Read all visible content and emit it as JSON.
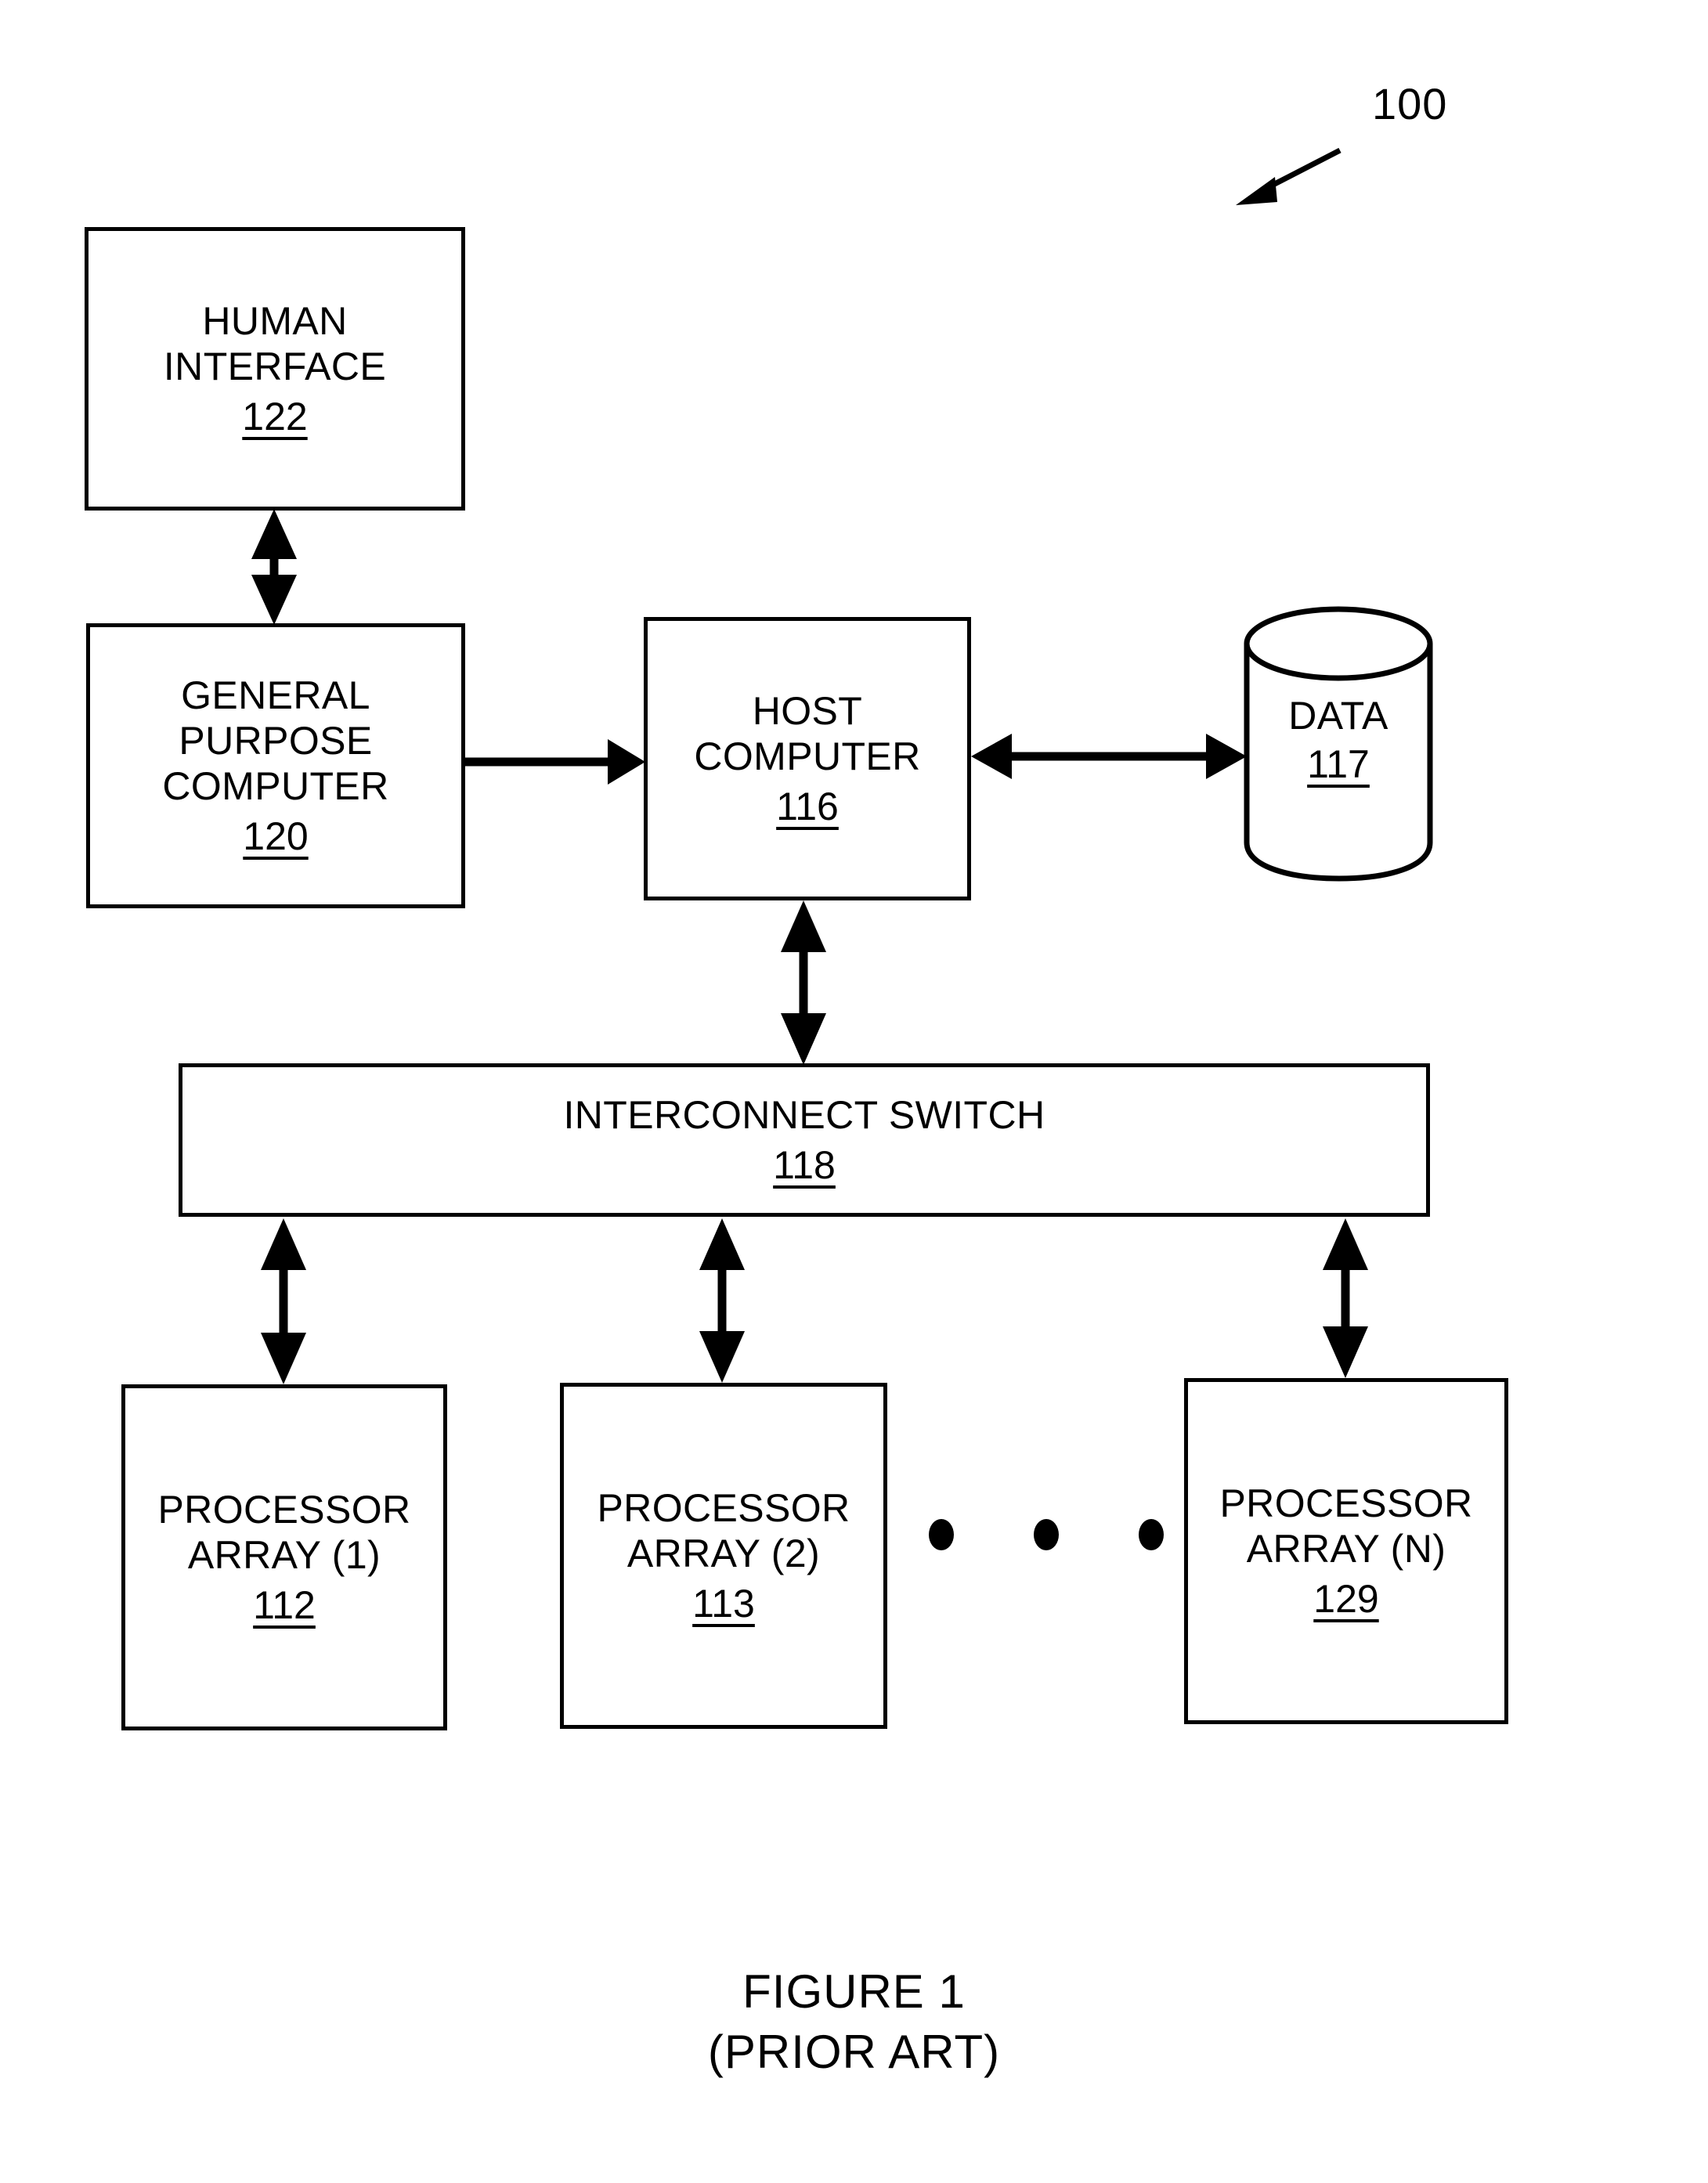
{
  "figure": {
    "system_reference": "100",
    "caption_line_1": "FIGURE 1",
    "caption_line_2": "(PRIOR ART)"
  },
  "nodes": {
    "human_interface": {
      "line_1": "HUMAN",
      "line_2": "INTERFACE",
      "ref": "122"
    },
    "general_purpose_computer": {
      "line_1": "GENERAL",
      "line_2": "PURPOSE",
      "line_3": "COMPUTER",
      "ref": "120"
    },
    "host_computer": {
      "line_1": "HOST",
      "line_2": "COMPUTER",
      "ref": "116"
    },
    "data_store": {
      "line_1": "DATA",
      "ref": "117"
    },
    "interconnect_switch": {
      "line_1": "INTERCONNECT SWITCH",
      "ref": "118"
    },
    "processor_array_1": {
      "line_1": "PROCESSOR",
      "line_2": "ARRAY (1)",
      "ref": "112"
    },
    "processor_array_2": {
      "line_1": "PROCESSOR",
      "line_2": "ARRAY (2)",
      "ref": "113"
    },
    "processor_array_n": {
      "line_1": "PROCESSOR",
      "line_2": "ARRAY (N)",
      "ref": "129"
    }
  },
  "colors": {
    "ink": "#000000",
    "paper": "#ffffff"
  }
}
